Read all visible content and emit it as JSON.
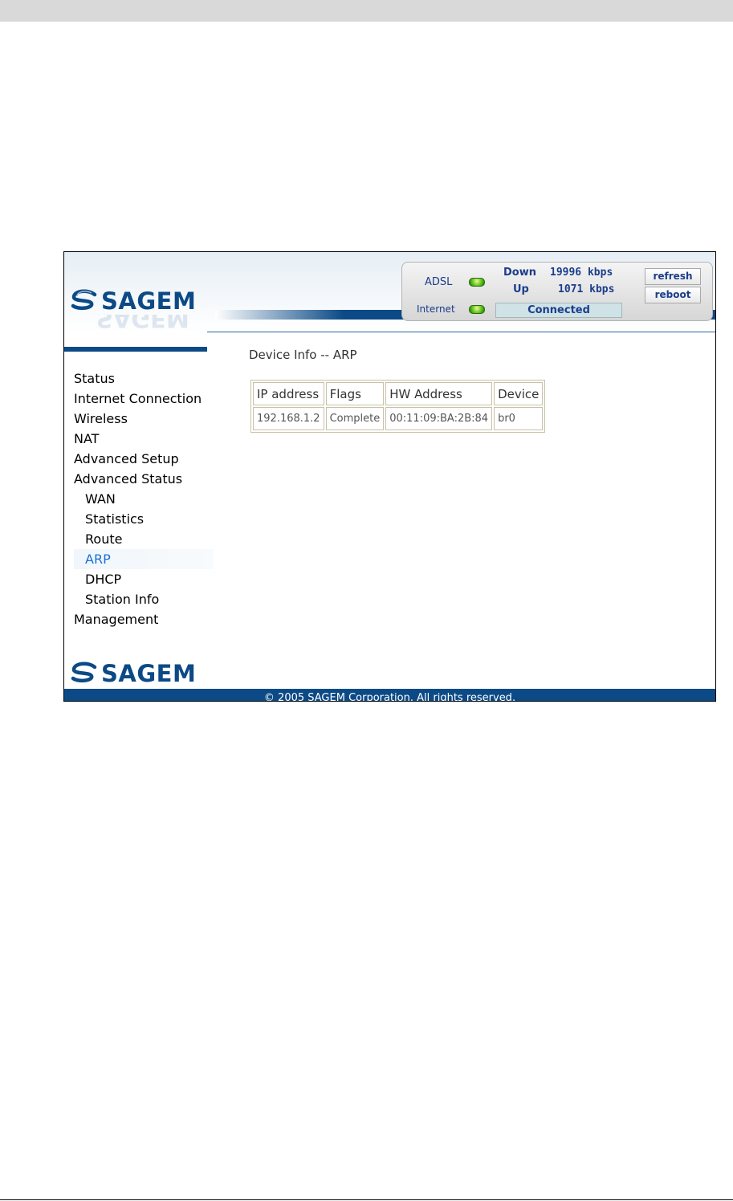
{
  "brand": {
    "logo_text": "SAGEM",
    "logo_reflection_text": "SAGEM"
  },
  "status_panel": {
    "adsl_label": "ADSL",
    "internet_label": "Internet",
    "down_label": "Down",
    "down_value": "19996 kbps",
    "up_label": "Up",
    "up_value": "1071 kbps",
    "connection_status": "Connected",
    "refresh_label": "refresh",
    "reboot_label": "reboot",
    "led_color": "#3fae0a"
  },
  "sidebar": {
    "items": [
      {
        "label": "Status"
      },
      {
        "label": "Internet Connection"
      },
      {
        "label": "Wireless"
      },
      {
        "label": "NAT"
      },
      {
        "label": "Advanced Setup"
      },
      {
        "label": "Advanced Status"
      },
      {
        "label": "WAN"
      },
      {
        "label": "Statistics"
      },
      {
        "label": "Route"
      },
      {
        "label": "ARP"
      },
      {
        "label": "DHCP"
      },
      {
        "label": "Station Info"
      },
      {
        "label": "Management"
      }
    ],
    "active_item": "ARP",
    "active_color": "#1a6fd6"
  },
  "main": {
    "title": "Device Info -- ARP",
    "table": {
      "headers": [
        "IP address",
        "Flags",
        "HW Address",
        "Device"
      ],
      "rows": [
        [
          "192.168.1.2",
          "Complete",
          "00:11:09:BA:2B:84",
          "br0"
        ]
      ]
    }
  },
  "footer": {
    "copyright": "© 2005 SAGEM Corporation. All rights reserved."
  },
  "colors": {
    "brand_blue": "#0b4a86"
  }
}
